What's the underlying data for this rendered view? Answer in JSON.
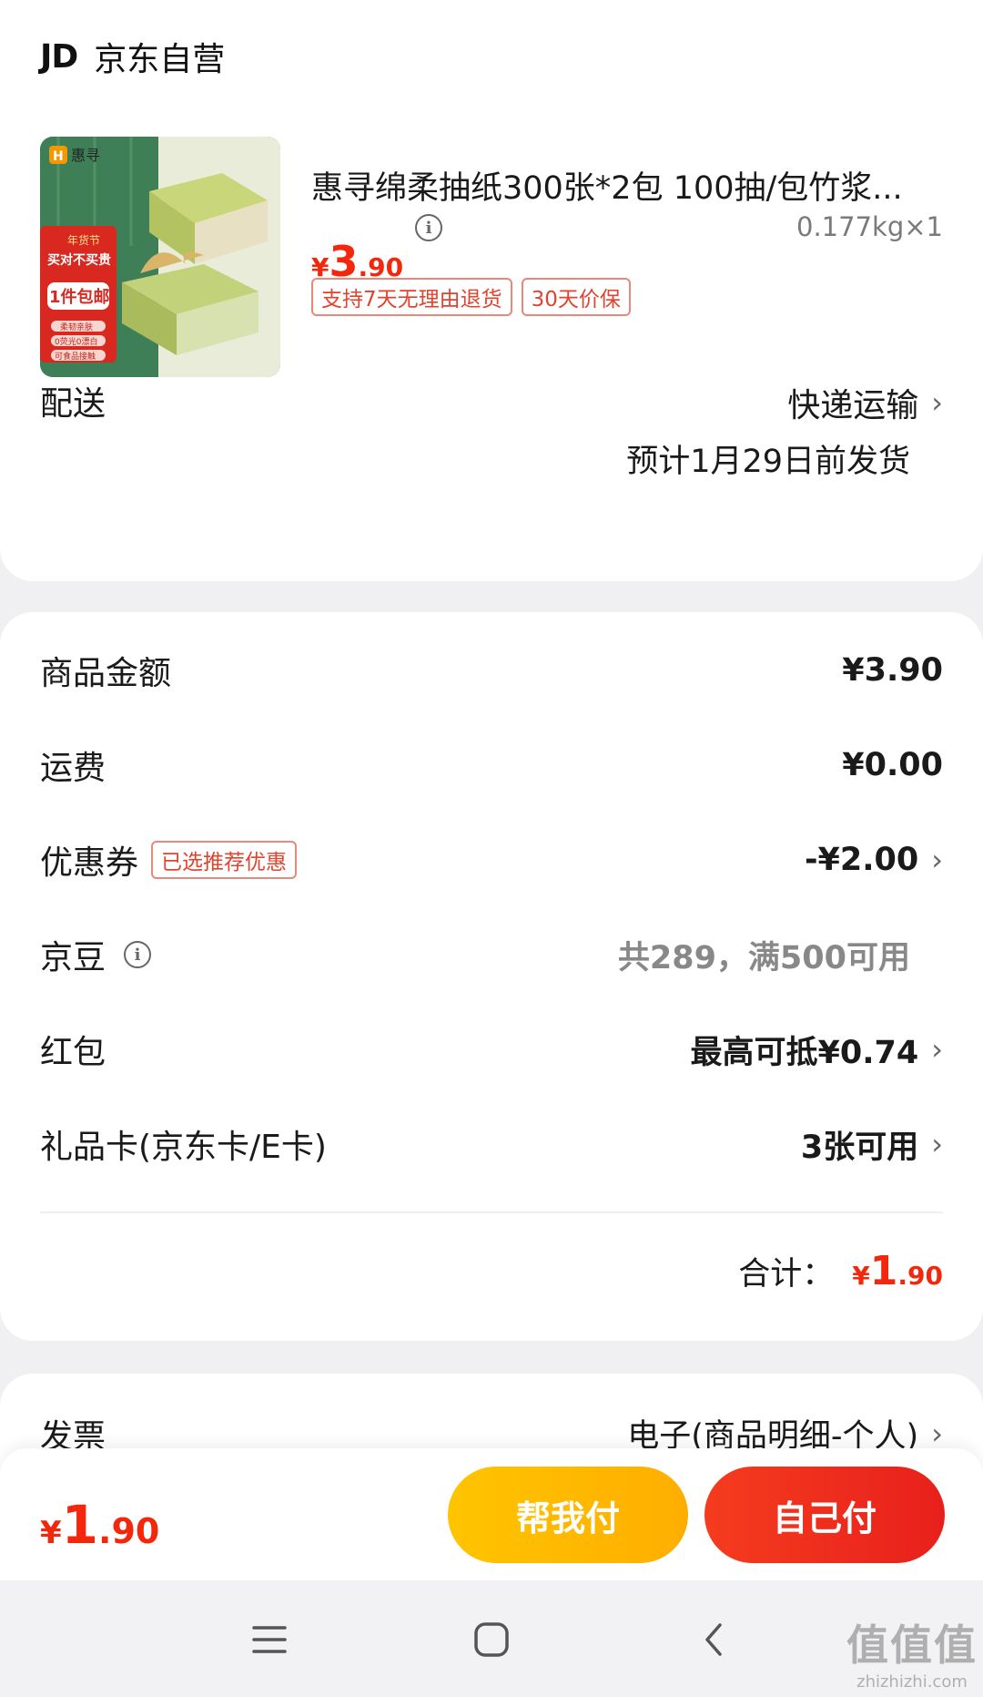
{
  "shop": {
    "logo": "JD",
    "name": "京东自营"
  },
  "product": {
    "title": "惠寻绵柔抽纸300张*2包 100抽/包竹浆...",
    "price_yen": "¥",
    "price_int": "3",
    "price_dec": ".90",
    "weight": "0.177kg×1",
    "tags": [
      "支持7天无理由退货",
      "30天价保"
    ],
    "image": {
      "brand": "惠寻",
      "banner_top": "年货节",
      "banner_main": "买对不买贵",
      "banner_big": "1件包邮",
      "features": [
        "柔韧亲肤",
        "0荧光0漂白",
        "可食品接触"
      ]
    }
  },
  "delivery": {
    "label": "配送",
    "method": "快递运输",
    "estimate": "预计1月29日前发货"
  },
  "fees": {
    "goods_amount": {
      "label": "商品金额",
      "value": "¥3.90"
    },
    "shipping": {
      "label": "运费",
      "value": "¥0.00"
    },
    "coupon": {
      "label": "优惠券",
      "badge": "已选推荐优惠",
      "value": "-¥2.00"
    },
    "jingdou": {
      "label": "京豆",
      "value": "共289，满500可用"
    },
    "red_packet": {
      "label": "红包",
      "value": "最高可抵¥0.74"
    },
    "gift_card": {
      "label": "礼品卡(京东卡/E卡)",
      "value": "3张可用"
    }
  },
  "total": {
    "label": "合计：",
    "yen": "¥",
    "int": "1",
    "dec": ".90"
  },
  "invoice": {
    "label": "发票",
    "value": "电子(商品明细-个人)"
  },
  "bottom_bar": {
    "yen": "¥",
    "int": "1",
    "dec": ".90",
    "help_pay": "帮我付",
    "self_pay": "自己付"
  },
  "watermark": {
    "big": "值值值",
    "small": "zhizhizhi.com"
  },
  "colors": {
    "accent_red": "#f2270c",
    "help_button": "#ffb800",
    "self_button": "#ee2d1e"
  }
}
